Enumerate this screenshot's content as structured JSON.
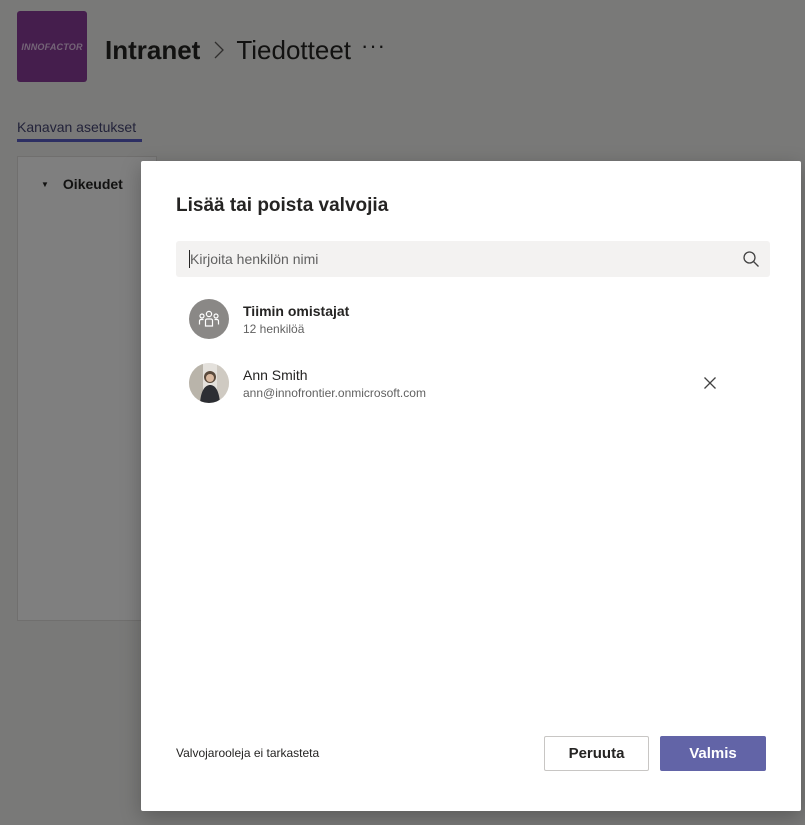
{
  "app": {
    "team_logo_text": "INNOFACTOR",
    "team_name": "Intranet",
    "channel_name": "Tiedotteet",
    "more_label": "···",
    "tab_label": "Kanavan asetukset",
    "section_label": "Oikeudet"
  },
  "dialog": {
    "title": "Lisää tai poista valvojia",
    "search_placeholder": "Kirjoita henkilön nimi",
    "search_value": "",
    "members": [
      {
        "name": "Tiimin omistajat",
        "subtitle": "12 henkilöä",
        "type": "group",
        "removable": false
      },
      {
        "name": "Ann Smith",
        "subtitle": "ann@innofrontier.onmicrosoft.com",
        "type": "person",
        "removable": true
      }
    ],
    "footer_note": "Valvojarooleja ei tarkasteta",
    "cancel_label": "Peruuta",
    "done_label": "Valmis"
  },
  "colors": {
    "accent": "#6264a7",
    "team_logo_bg": "#8a3d9a",
    "overlay": "rgba(0,0,0,0.5)"
  },
  "icons": [
    "search-icon",
    "close-icon",
    "team-icon",
    "chevron-right-icon",
    "caret-down-icon"
  ]
}
